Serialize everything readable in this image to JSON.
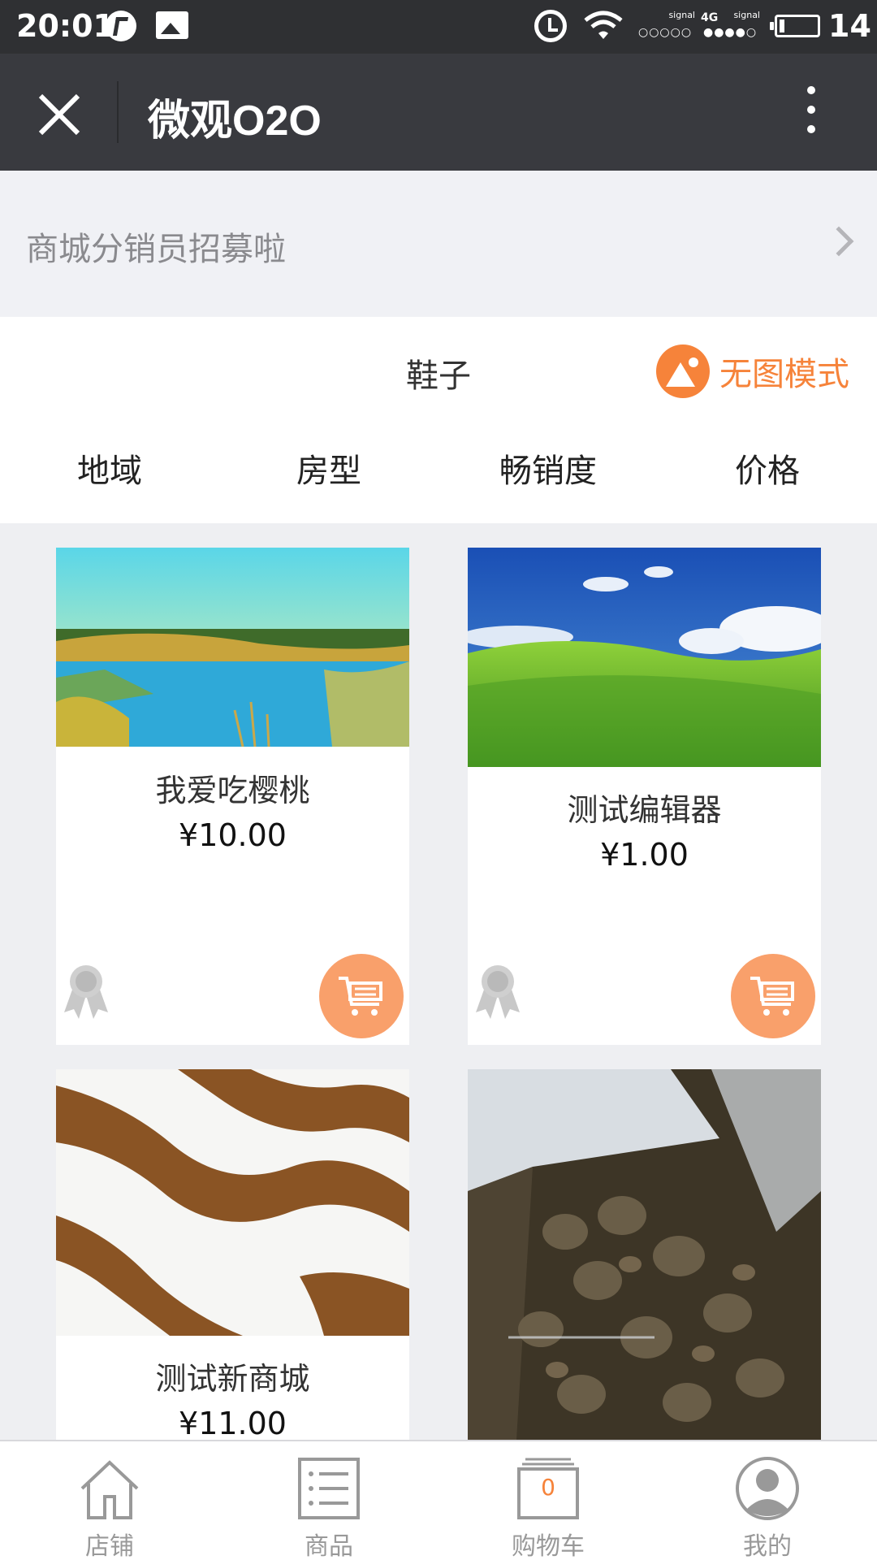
{
  "status_bar": {
    "time": "20:01",
    "signal_label_1": "signal",
    "signal_label_2": "signal",
    "network": "4G",
    "battery_level": "14",
    "battery_fraction": 0.14
  },
  "header": {
    "title": "微观O2O"
  },
  "banner": {
    "text": "商城分销员招募啦"
  },
  "category": {
    "title": "鞋子",
    "no_image_mode_label": "无图模式",
    "filters": [
      "地域",
      "房型",
      "畅销度",
      "价格"
    ]
  },
  "products": [
    {
      "name": "我爱吃樱桃",
      "price": "¥10.00",
      "image": "lake-landscape"
    },
    {
      "name": "测试编辑器",
      "price": "¥1.00",
      "image": "green-hills"
    },
    {
      "name": "测试新商城",
      "price": "¥11.00",
      "image": "brown-waves"
    },
    {
      "name": "",
      "price": "",
      "image": "taro-roots"
    }
  ],
  "bottom_nav": {
    "items": [
      {
        "label": "店铺",
        "icon": "home-icon"
      },
      {
        "label": "商品",
        "icon": "list-icon"
      },
      {
        "label": "购物车",
        "icon": "cart-icon",
        "count": "0"
      },
      {
        "label": "我的",
        "icon": "profile-icon"
      }
    ]
  },
  "colors": {
    "accent": "#f6833a",
    "cart_button": "#f9a06b",
    "title_bar": "#393a3f",
    "status_bar": "#2f3033"
  }
}
